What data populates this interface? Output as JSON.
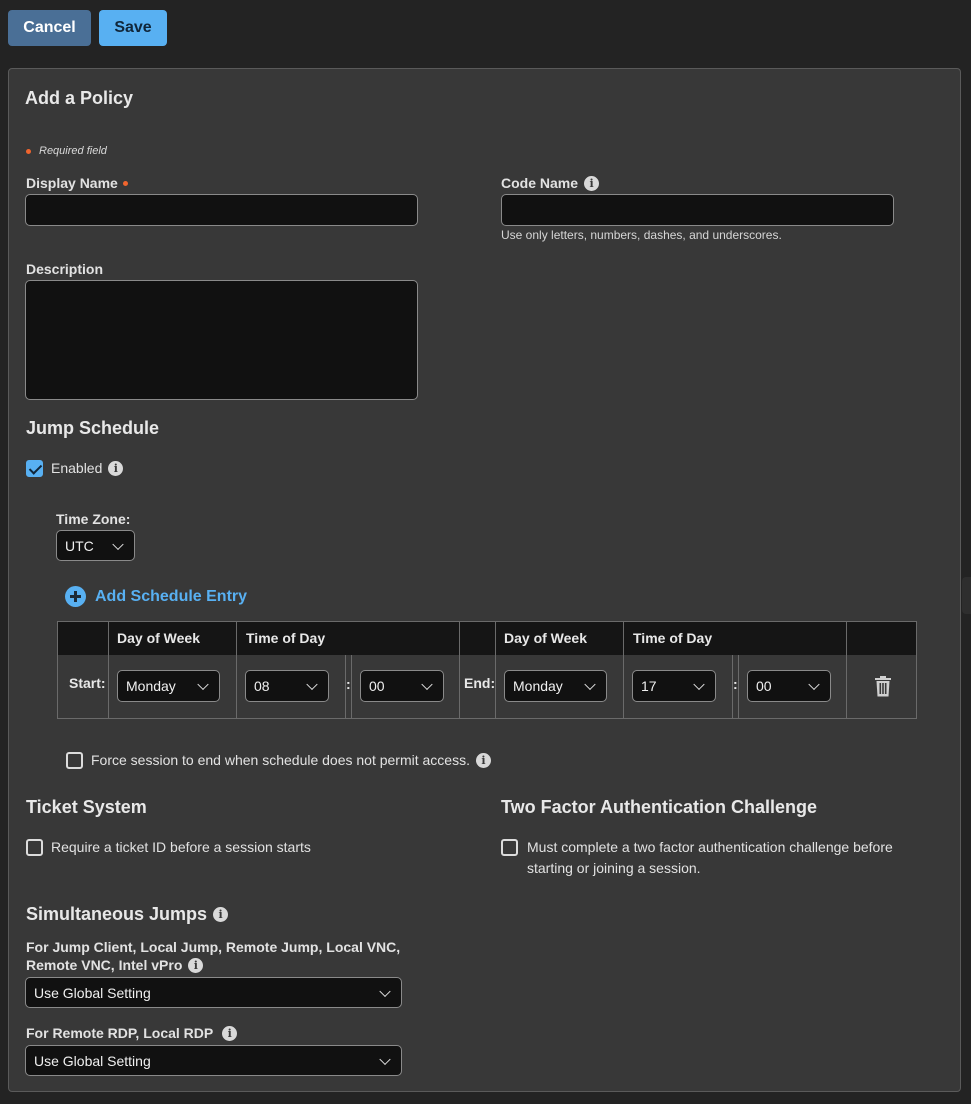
{
  "toolbar": {
    "cancel_label": "Cancel",
    "save_label": "Save"
  },
  "panel": {
    "title": "Add a Policy",
    "required_note": "Required field",
    "display_name": {
      "label": "Display Name",
      "value": ""
    },
    "code_name": {
      "label": "Code Name",
      "value": "",
      "hint": "Use only letters, numbers, dashes, and underscores."
    },
    "description": {
      "label": "Description",
      "value": ""
    }
  },
  "jump_schedule": {
    "title": "Jump Schedule",
    "enabled_label": "Enabled",
    "enabled": true,
    "timezone_label": "Time Zone:",
    "timezone_value": "UTC",
    "add_entry_label": "Add Schedule Entry",
    "columns": [
      "Day of Week",
      "Time of Day",
      "Day of Week",
      "Time of Day"
    ],
    "start_label": "Start:",
    "end_label": "End:",
    "start": {
      "day": "Monday",
      "hour": "08",
      "minute": "00"
    },
    "end": {
      "day": "Monday",
      "hour": "17",
      "minute": "00"
    },
    "time_separator": ":",
    "force_end_label": "Force session to end when schedule does not permit access.",
    "force_end_checked": false
  },
  "ticket_system": {
    "title": "Ticket System",
    "require_label": "Require a ticket ID before a session starts",
    "checked": false
  },
  "two_factor": {
    "title": "Two Factor Authentication Challenge",
    "line1": "Must complete a two factor authentication challenge before",
    "line2": "starting or joining a session.",
    "checked": false
  },
  "simultaneous": {
    "title": "Simultaneous Jumps",
    "jump_label_line1": "For Jump Client, Local Jump, Remote Jump, Local VNC,",
    "jump_label_line2": "Remote VNC, Intel vPro",
    "jump_value": "Use Global Setting",
    "rdp_label": "For Remote RDP, Local RDP",
    "rdp_value": "Use Global Setting"
  },
  "colors": {
    "accent": "#58b0f2",
    "cancel": "#4a6f96",
    "required": "#f0652e",
    "panel": "#383838",
    "background": "#232323"
  },
  "icons": {
    "info": "info-icon",
    "add": "plus-circle-icon",
    "delete": "trash-icon",
    "dropdown": "chevron-down-icon"
  }
}
